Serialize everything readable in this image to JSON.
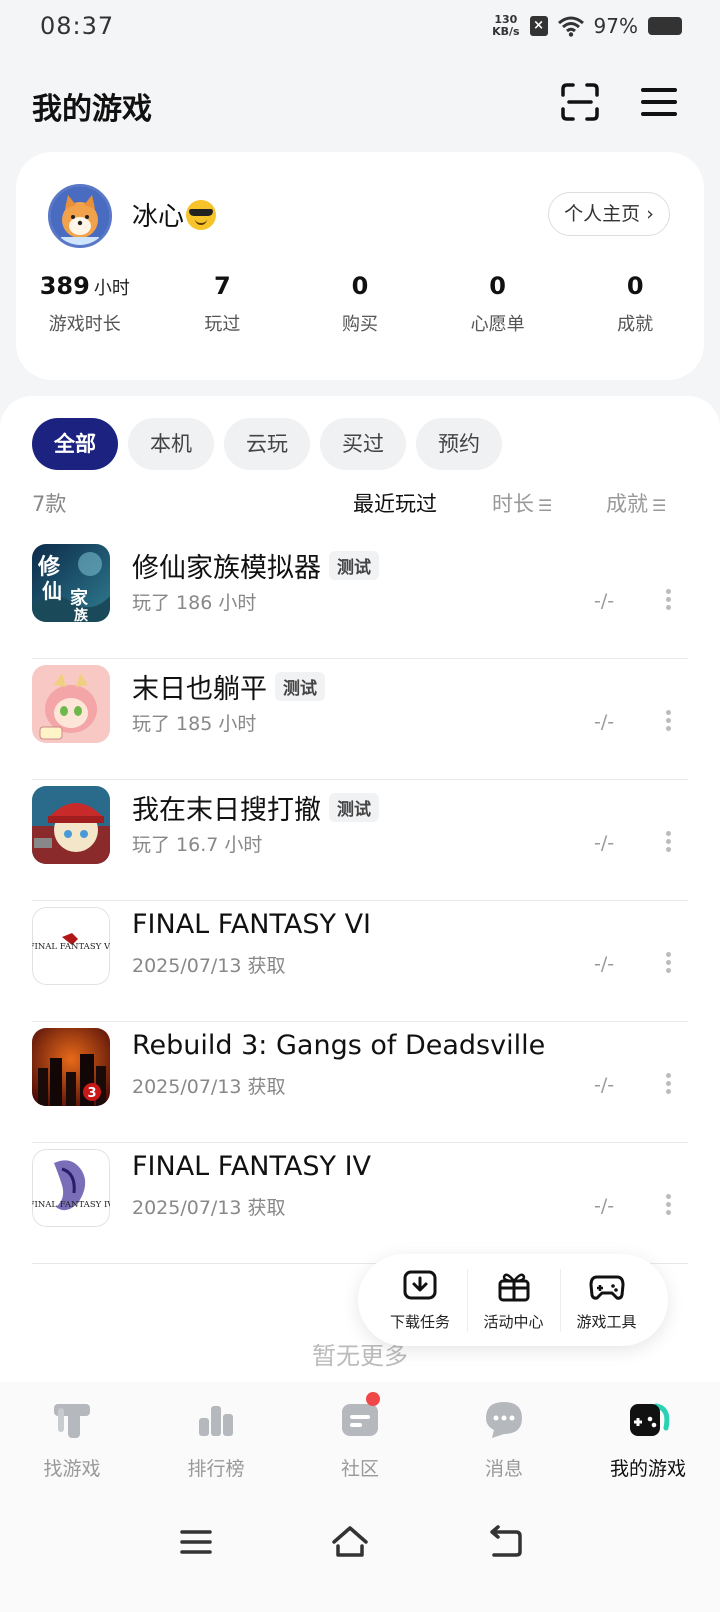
{
  "status": {
    "time": "08:37",
    "net_speed_value": "130",
    "net_speed_unit": "KB/s",
    "battery": "97%"
  },
  "header": {
    "title": "我的游戏"
  },
  "profile": {
    "username": "冰心",
    "homepage_label": "个人主页 ›",
    "stats": [
      {
        "value": "389",
        "unit": "小时",
        "label": "游戏时长"
      },
      {
        "value": "7",
        "unit": "",
        "label": "玩过"
      },
      {
        "value": "0",
        "unit": "",
        "label": "购买"
      },
      {
        "value": "0",
        "unit": "",
        "label": "心愿单"
      },
      {
        "value": "0",
        "unit": "",
        "label": "成就"
      }
    ]
  },
  "filters": {
    "tabs": [
      "全部",
      "本机",
      "云玩",
      "买过",
      "预约"
    ],
    "active": "全部"
  },
  "list": {
    "count": "7款",
    "sort_recent": "最近玩过",
    "sort_time": "时长",
    "sort_ach": "成就",
    "games": [
      {
        "name": "修仙家族模拟器",
        "badge": "测试",
        "sub": "玩了 186 小时",
        "ach": "-/-"
      },
      {
        "name": "末日也躺平",
        "badge": "测试",
        "sub": "玩了 185 小时",
        "ach": "-/-"
      },
      {
        "name": "我在末日搜打撤",
        "badge": "测试",
        "sub": "玩了 16.7 小时",
        "ach": "-/-"
      },
      {
        "name": "FINAL FANTASY VI",
        "badge": "",
        "sub": "2025/07/13 获取",
        "ach": "-/-"
      },
      {
        "name": "Rebuild 3: Gangs of Deadsville",
        "badge": "",
        "sub": "2025/07/13 获取",
        "ach": "-/-"
      },
      {
        "name": "FINAL FANTASY IV",
        "badge": "",
        "sub": "2025/07/13 获取",
        "ach": "-/-"
      }
    ],
    "no_more": "暂无更多"
  },
  "float_bar": {
    "items": [
      "下载任务",
      "活动中心",
      "游戏工具"
    ]
  },
  "bottom_nav": {
    "items": [
      "找游戏",
      "排行榜",
      "社区",
      "消息",
      "我的游戏"
    ],
    "active": "我的游戏"
  },
  "icon_logos": {
    "ff6": "FINAL FANTASY VI",
    "ff4": "FINAL FANTASY IV"
  },
  "colors": {
    "accent": "#1c2280",
    "badge_dot": "#f04848"
  }
}
